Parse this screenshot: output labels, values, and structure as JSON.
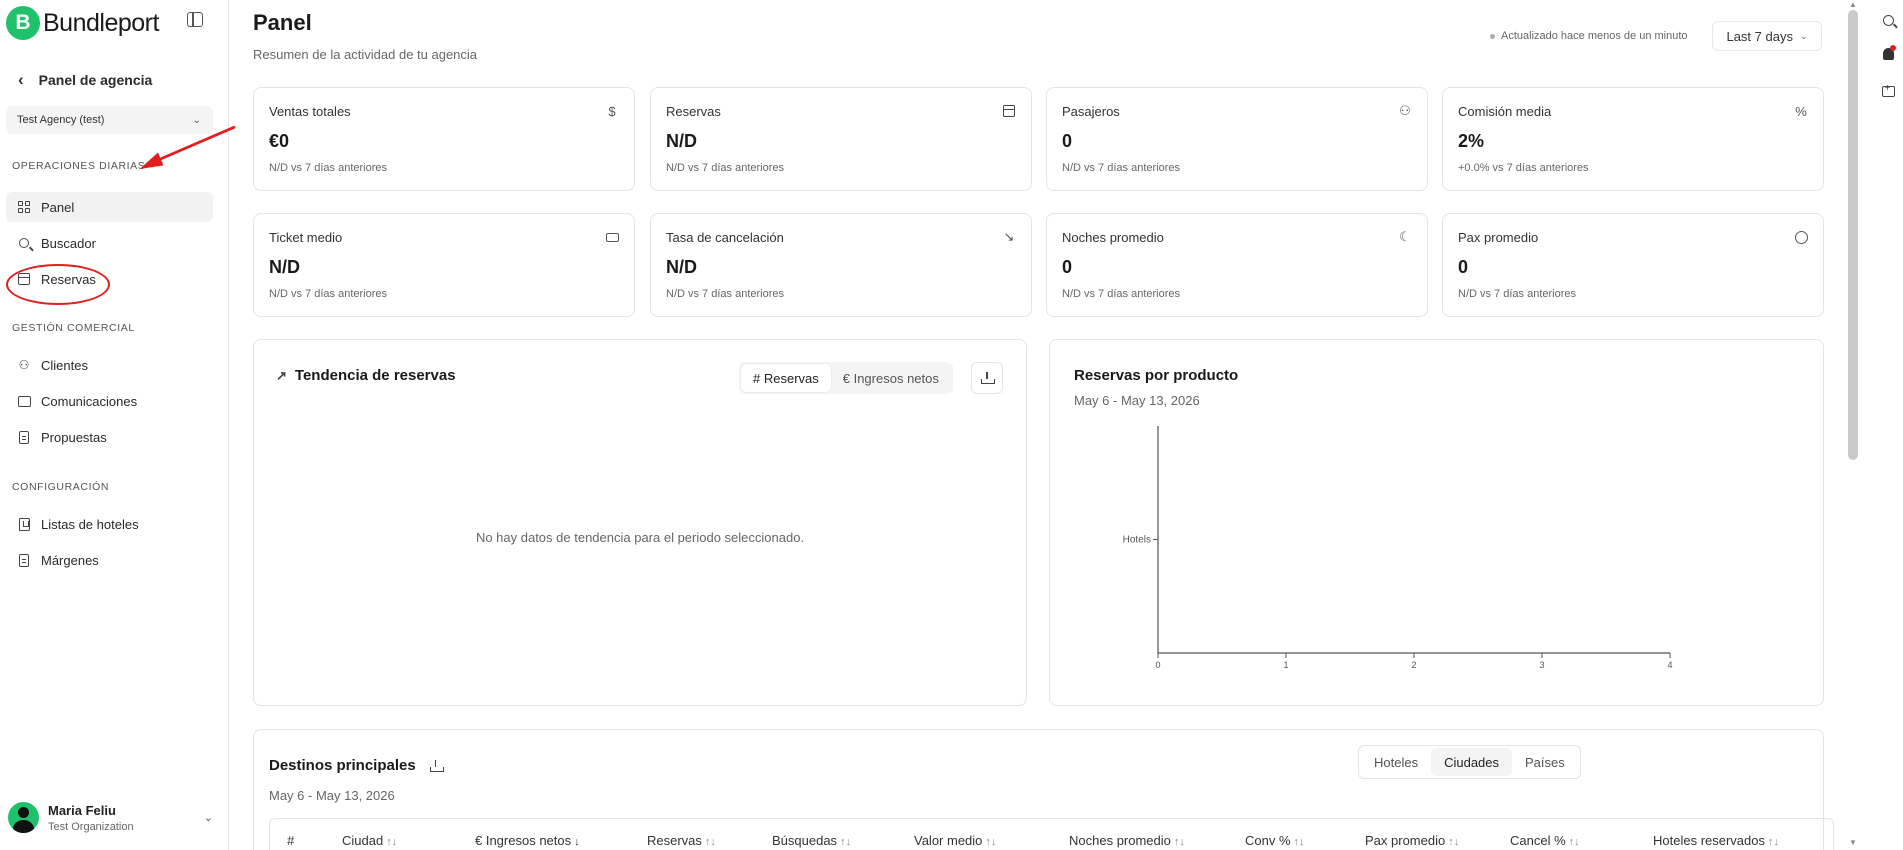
{
  "sidebar": {
    "brand": "Bundleport",
    "brand_letter": "B",
    "back_label": "Panel de agencia",
    "agency": "Test Agency (test)",
    "sections": [
      {
        "label": "OPERACIONES DIARIAS",
        "items": [
          {
            "label": "Panel"
          },
          {
            "label": "Buscador"
          },
          {
            "label": "Reservas"
          }
        ]
      },
      {
        "label": "GESTIÓN COMERCIAL",
        "items": [
          {
            "label": "Clientes"
          },
          {
            "label": "Comunicaciones"
          },
          {
            "label": "Propuestas"
          }
        ]
      },
      {
        "label": "CONFIGURACIÓN",
        "items": [
          {
            "label": "Listas de hoteles"
          },
          {
            "label": "Márgenes"
          }
        ]
      }
    ],
    "user": {
      "name": "Maria Feliu",
      "org": "Test Organization"
    }
  },
  "header": {
    "title": "Panel",
    "subtitle": "Resumen de la actividad de tu agencia",
    "updated": "Actualizado hace menos de un minuto",
    "range": "Last 7 days"
  },
  "kpis": [
    {
      "label": "Ventas totales",
      "value": "€0",
      "delta": "N/D vs 7 días anteriores",
      "icon": "$"
    },
    {
      "label": "Reservas",
      "value": "N/D",
      "delta": "N/D vs 7 días anteriores",
      "icon": "calendar-icon"
    },
    {
      "label": "Pasajeros",
      "value": "0",
      "delta": "N/D vs 7 días anteriores",
      "icon": "users-icon"
    },
    {
      "label": "Comisión media",
      "value": "2%",
      "delta": "+0.0% vs 7 días anteriores",
      "icon": "%"
    },
    {
      "label": "Ticket medio",
      "value": "N/D",
      "delta": "N/D vs 7 días anteriores",
      "icon": "ticket-icon"
    },
    {
      "label": "Tasa de cancelación",
      "value": "N/D",
      "delta": "N/D vs 7 días anteriores",
      "icon": "trending-down-icon"
    },
    {
      "label": "Noches promedio",
      "value": "0",
      "delta": "N/D vs 7 días anteriores",
      "icon": "moon-icon"
    },
    {
      "label": "Pax promedio",
      "value": "0",
      "delta": "N/D vs 7 días anteriores",
      "icon": "user-circle-icon"
    }
  ],
  "trend": {
    "title": "Tendencia de reservas",
    "toggle_reservas": "# Reservas",
    "toggle_ingresos": "€ Ingresos netos",
    "empty": "No hay datos de tendencia para el periodo seleccionado."
  },
  "product": {
    "title": "Reservas por producto",
    "date": "May 6 - May 13, 2026"
  },
  "chart_data": {
    "type": "bar",
    "orientation": "horizontal",
    "categories": [
      "Hotels"
    ],
    "values": [
      0
    ],
    "xlim": [
      0,
      4
    ],
    "xticks": [
      "0",
      "1",
      "2",
      "3",
      "4"
    ],
    "grid": false
  },
  "destinations": {
    "title": "Destinos principales",
    "date": "May 6 - May 13, 2026",
    "tabs": [
      "Hoteles",
      "Ciudades",
      "Países"
    ],
    "active_tab": "Ciudades",
    "columns": [
      "#",
      "Ciudad",
      "€ Ingresos netos",
      "Reservas",
      "Búsquedas",
      "Valor medio",
      "Noches promedio",
      "Conv %",
      "Pax promedio",
      "Cancel %",
      "Hoteles reservados"
    ],
    "sorted_column": "€ Ingresos netos"
  },
  "colors": {
    "brand": "#1fc16b",
    "highlight": "#e21d1d"
  }
}
